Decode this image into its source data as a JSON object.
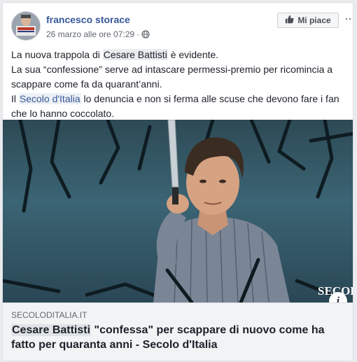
{
  "post": {
    "author": "francesco storace",
    "timestamp": "26 marzo alle ore 07:29",
    "separator": "·",
    "like_label": "Mi piace",
    "more_label": "···",
    "text": {
      "line1_pre": "La nuova trappola di ",
      "line1_mention": "Cesare Battisti",
      "line1_post": " è evidente.",
      "line2": "La sua “confessione” serve ad intascare permessi-premio per ricomincia a scappare come fa da quarant’anni.",
      "line3_pre": "Il ",
      "line3_link": "Secolo d'Italia",
      "line3_post": " lo denuncia e non si ferma alle scuse che devono fare i fan che lo hanno coccolato."
    },
    "image": {
      "watermark": "SECOL",
      "info_label": "i"
    },
    "link_preview": {
      "domain": "SECOLODITALIA.IT",
      "title_mention": "Cesare Battisti",
      "title_rest": " \"confessa\" per scappare di nuovo come ha fatto per quaranta anni - Secolo d'Italia"
    }
  },
  "colors": {
    "link_blue": "#365899",
    "text": "#1d2129",
    "meta_gray": "#616770",
    "background": "#e9ebee"
  },
  "icons": [
    "avatar",
    "globe-icon",
    "thumbs-up-icon",
    "more-icon",
    "info-icon"
  ]
}
